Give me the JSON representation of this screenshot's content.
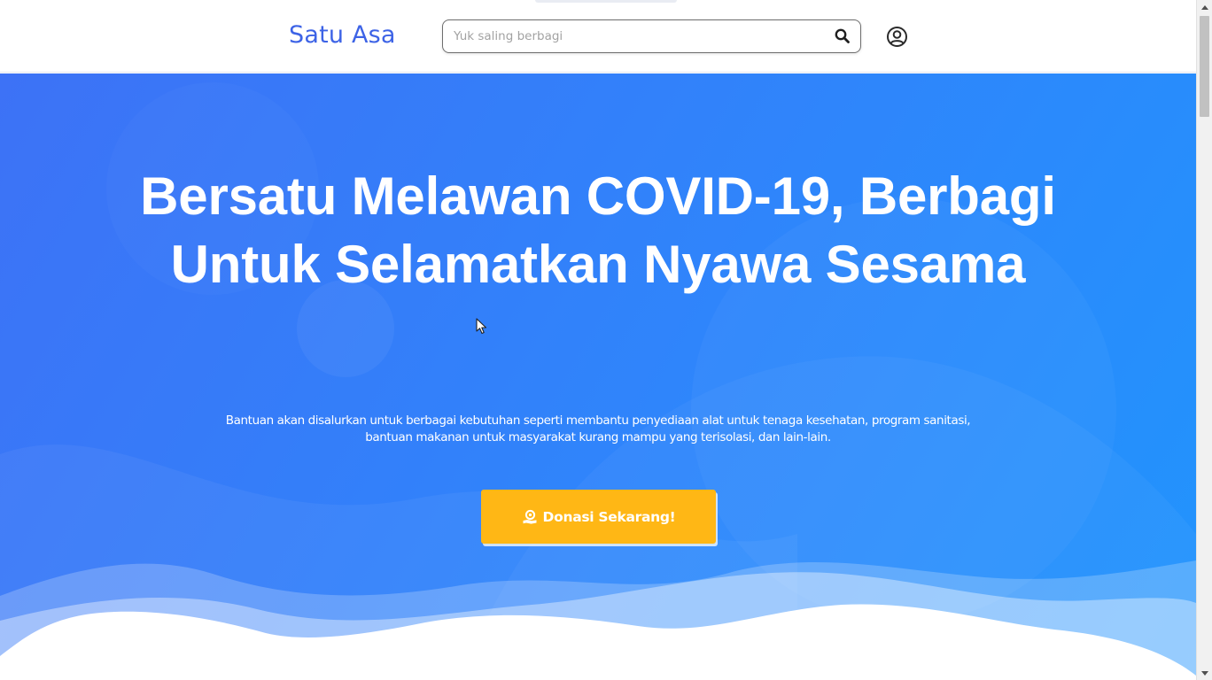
{
  "navbar": {
    "brand": "Satu Asa",
    "search": {
      "placeholder": "Yuk saling berbagi",
      "value": "",
      "button_icon": "search-icon"
    },
    "account_icon": "user-circle-icon"
  },
  "hero": {
    "title_lines": [
      "Bersatu Melawan COVID-19, Berbagi",
      "Untuk Selamatkan Nyawa Sesama"
    ],
    "description_lines": [
      "Bantuan akan disalurkan untuk berbagai kebutuhan seperti membantu penyediaan alat untuk tenaga kesehatan, program sanitasi,",
      "bantuan makanan untuk masyarakat kurang mampu yang terisolasi, dan lain-lain."
    ],
    "cta": {
      "label": "Donasi Sekarang!",
      "icon": "hand-holding-coin-icon"
    }
  },
  "colors": {
    "brand": "#3d63e6",
    "hero_gradient_start": "#3d72f6",
    "hero_gradient_end": "#2194fd",
    "cta_background": "#ffb715",
    "text_on_hero": "#ffffff"
  }
}
